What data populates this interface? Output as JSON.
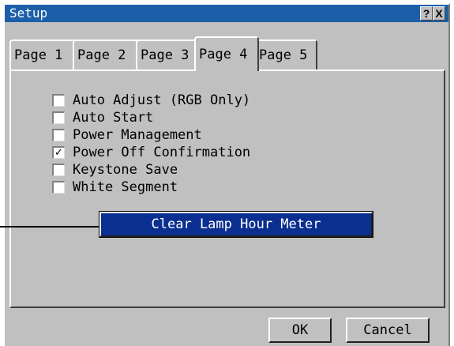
{
  "window": {
    "title": "Setup",
    "help_label": "?",
    "close_label": "X"
  },
  "tabs": [
    {
      "label": "Page 1"
    },
    {
      "label": "Page 2"
    },
    {
      "label": "Page 3"
    },
    {
      "label": "Page 4",
      "active": true
    },
    {
      "label": "Page 5"
    }
  ],
  "options": [
    {
      "label": "Auto Adjust (RGB Only)",
      "checked": false,
      "mark": ""
    },
    {
      "label": "Auto Start",
      "checked": false,
      "mark": ""
    },
    {
      "label": "Power Management",
      "checked": false,
      "mark": ""
    },
    {
      "label": "Power Off Confirmation",
      "checked": true,
      "mark": "✓"
    },
    {
      "label": "Keystone Save",
      "checked": false,
      "mark": ""
    },
    {
      "label": "White Segment",
      "checked": false,
      "mark": ""
    }
  ],
  "clear_button": {
    "label": "Clear Lamp Hour Meter"
  },
  "footer": {
    "ok_label": "OK",
    "cancel_label": "Cancel"
  },
  "colors": {
    "title_bar": "#1c5fa8",
    "selected_button": "#0b2f91",
    "dialog": "#c0c0c0"
  }
}
